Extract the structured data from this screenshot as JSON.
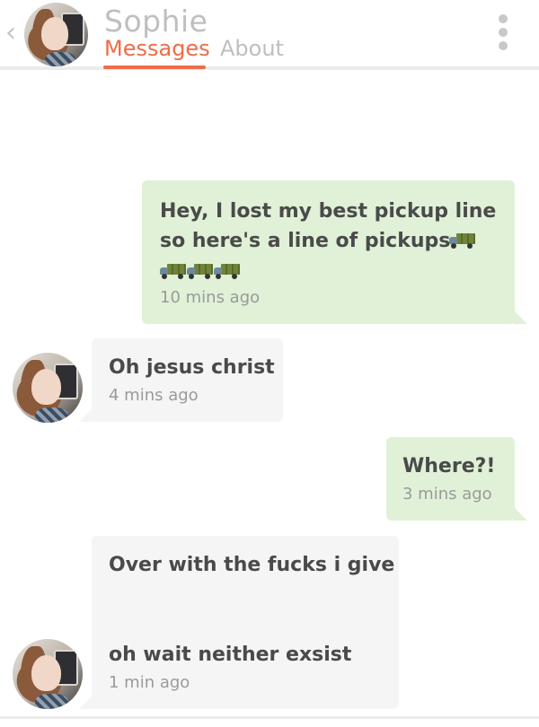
{
  "header": {
    "back_glyph": "‹",
    "contact_name": "Sophie",
    "tabs": [
      {
        "label": "Messages",
        "active": true
      },
      {
        "label": "About",
        "active": false
      }
    ],
    "accent_color": "#ee6c47",
    "menu_icon": "more-vertical-icon"
  },
  "messages": [
    {
      "direction": "sent",
      "lines": [
        "Hey, I lost my best pickup line",
        "so here's a line of pickups."
      ],
      "emoji": "pickup-truck-emoji",
      "emoji_count": 4,
      "time": "10 mins ago"
    },
    {
      "direction": "received",
      "lines": [
        "Oh jesus christ"
      ],
      "time": "4 mins ago"
    },
    {
      "direction": "sent",
      "lines": [
        "Where?!"
      ],
      "time": "3 mins ago"
    },
    {
      "direction": "received",
      "lines": [
        "Over with the fucks i give",
        "oh wait neither exsist"
      ],
      "time": "1 min ago"
    }
  ],
  "colors": {
    "sent_bubble": "#e0f1d7",
    "received_bubble": "#f5f5f5"
  }
}
